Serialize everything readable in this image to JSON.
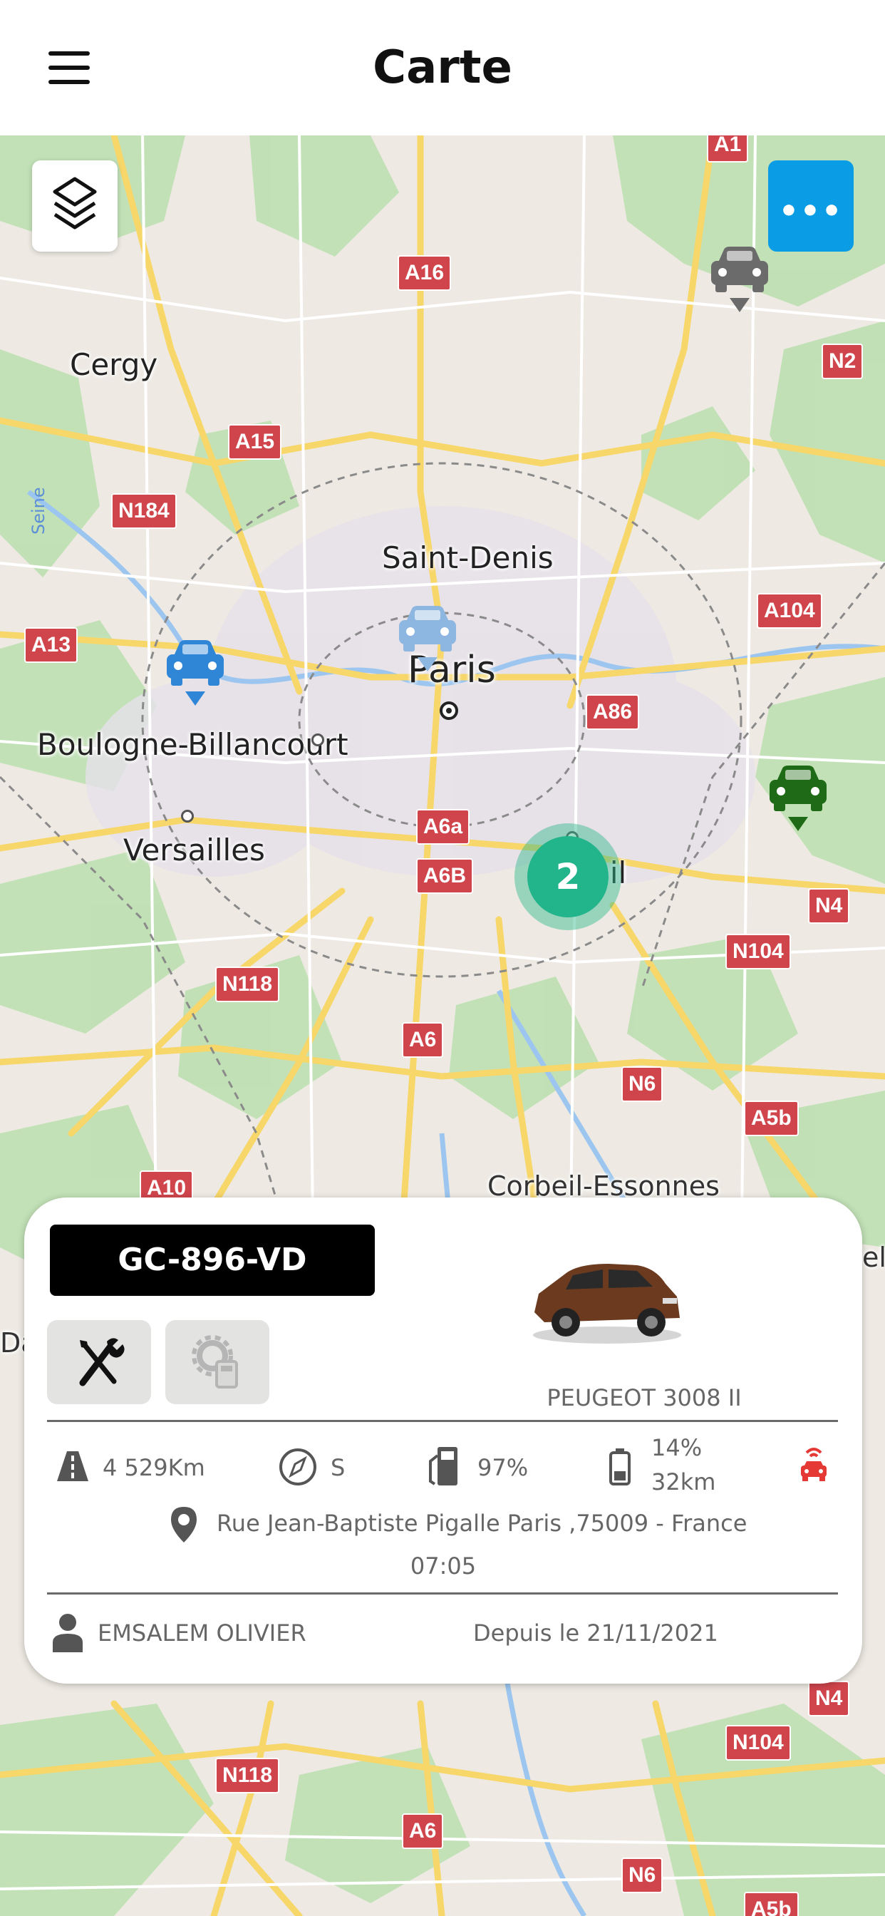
{
  "header": {
    "title": "Carte",
    "menu_icon": "hamburger-menu-icon"
  },
  "map": {
    "places": {
      "cergy": "Cergy",
      "saint_denis": "Saint-Denis",
      "paris": "Paris",
      "boulogne": "Boulogne-Billancourt",
      "versailles": "Versailles",
      "creteil": "Créteil",
      "corbeil": "Corbeil-Essonnes",
      "seine": "Seine",
      "edge_left": "Da",
      "edge_right": "el"
    },
    "roads": {
      "a1": "A1",
      "a16": "A16",
      "n2": "N2",
      "a15": "A15",
      "n184": "N184",
      "a104": "A104",
      "a13": "A13",
      "a86": "A86",
      "a6a": "A6a",
      "a6b": "A6B",
      "n4": "N4",
      "n104": "N104",
      "n118": "N118",
      "a6": "A6",
      "n6": "N6",
      "a5b": "A5b",
      "a10": "A10",
      "n4_b": "N4",
      "n104_b": "N104",
      "n118_b": "N118",
      "a6_b": "A6",
      "n6_b": "N6",
      "a5b_b": "A5b"
    },
    "cluster_count": "2",
    "markers": {
      "grey": {
        "color": "#6b6b6b",
        "icon": "car-marker-icon"
      },
      "blue": {
        "color": "#2f86d6",
        "icon": "car-marker-icon"
      },
      "light_blue": {
        "color": "#8db6e0",
        "icon": "car-marker-icon"
      },
      "green": {
        "color": "#1f6a16",
        "icon": "car-marker-icon"
      }
    },
    "colors": {
      "cluster": "#22b48a",
      "more_button": "#0a9ce4",
      "road_label": "#d0454c"
    }
  },
  "vehicle_card": {
    "plate": "GC-896-VD",
    "model": "PEUGEOT 3008 II",
    "mileage": "4 529Km",
    "heading": "S",
    "fuel": "97%",
    "battery_percent": "14%",
    "battery_range": "32km",
    "address": "Rue Jean-Baptiste Pigalle Paris ,75009 - France",
    "time": "07:05",
    "driver": "EMSALEM OLIVIER",
    "since": "Depuis le 21/11/2021",
    "alert_color": "#e53935"
  }
}
